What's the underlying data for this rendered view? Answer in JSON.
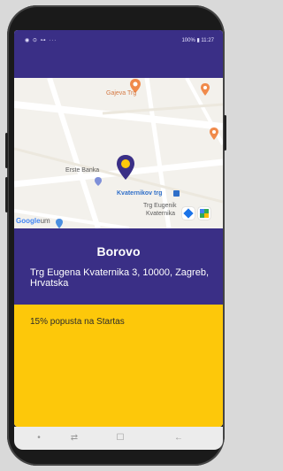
{
  "status_bar": {
    "left_icons": "◉ ⊙ ⊶ ···",
    "right_text": "100% ▮ 11:27"
  },
  "map": {
    "poi_top": "Gajeva Trg",
    "poi_bank": "Erste Banka",
    "poi_square": "Kvaternikov trg",
    "poi_stop_line1": "Trg Eugenik",
    "poi_stop_line2": "Kvaternika",
    "google_logo": "Google",
    "google_suffix": "um"
  },
  "store": {
    "name": "Borovo",
    "address": "Trg Eugena Kvaternika 3, 10000, Zagreb, Hrvatska"
  },
  "promo": {
    "text": "15% popusta na Startas"
  },
  "navbar": {
    "dot": "•",
    "recent": "⇄",
    "home": "☐",
    "back": "←"
  },
  "colors": {
    "brand_purple": "#3a2f86",
    "promo_yellow": "#fdc80a"
  }
}
